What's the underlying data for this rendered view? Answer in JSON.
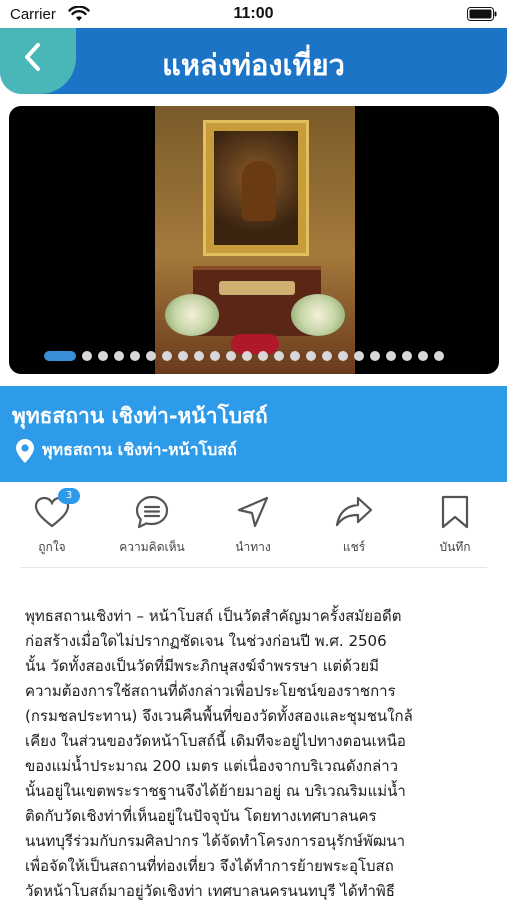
{
  "status_bar": {
    "carrier": "Carrier",
    "time": "11:00",
    "wifi_icon": "wifi-icon",
    "battery_icon": "battery-icon"
  },
  "header": {
    "title": "แหล่งท่องเที่ยว",
    "back_icon": "chevron-left-icon",
    "colors": {
      "bar": "#1c74c7",
      "back": "#49b7b8"
    }
  },
  "carousel": {
    "photo_alt": "ภาพถ่ายภายในวัด",
    "slide_count": 24,
    "active_index": 0
  },
  "place": {
    "name": "พุทธสถาน เชิงท่า-หน้าโบสถ์",
    "location": "พุทธสถาน เชิงท่า-หน้าโบสถ์",
    "location_icon": "map-pin-icon",
    "color": "#2d9bea"
  },
  "actions": [
    {
      "label": "ถูกใจ",
      "icon": "heart-icon",
      "badge": "3"
    },
    {
      "label": "ความคิดเห็น",
      "icon": "comment-icon"
    },
    {
      "label": "นำทาง",
      "icon": "navigation-icon"
    },
    {
      "label": "แชร์",
      "icon": "share-icon"
    },
    {
      "label": "บันทึก",
      "icon": "bookmark-icon"
    }
  ],
  "description": "พุทธสถานเชิงท่า – หน้าโบสถ์ เป็นวัดสำคัญมาครั้งสมัยอดีต\nก่อสร้างเมื่อใดไม่ปรากฏชัดเจน ในช่วงก่อนปี พ.ศ. 2506\nนั้น วัดทั้งสองเป็นวัดที่มีพระภิกษุสงฆ์จำพรรษา แต่ด้วยมี\nความต้องการใช้สถานที่ดังกล่าวเพื่อประโยชน์ของราชการ\n(กรมชลประทาน) จึงเวนคืนพื้นที่ของวัดทั้งสองและชุมชนใกล้\nเคียง ในส่วนของวัดหน้าโบสถ์นี้ เดิมทีจะอยู่ไปทางตอนเหนือ\nของแม่น้ำประมาณ 200 เมตร แต่เนื่องจากบริเวณดังกล่าว\nนั้นอยู่ในเขตพระราชฐานจึงได้ย้ายมาอยู่ ณ บริเวณริมแม่น้ำ\nติดกับวัดเชิงท่าที่เห็นอยู่ในปัจจุบัน โดยทางเทศบาลนคร\nนนทบุรีร่วมกับกรมศิลปากร ได้จัดทำโครงการอนุรักษ์พัฒนา\nเพื่อจัดให้เป็นสถานที่ท่องเที่ยว จึงได้ทำการย้ายพระอุโบสถ\nวัดหน้าโบสถ์มาอยู่วัดเชิงท่า เทศบาลนครนนทบุรี ได้ทำพิธี"
}
